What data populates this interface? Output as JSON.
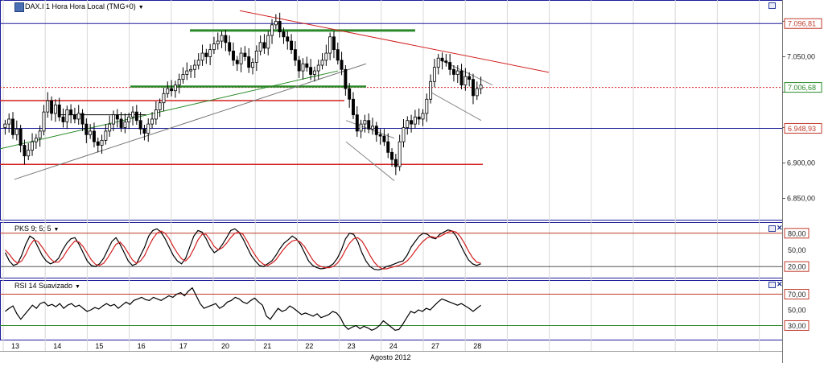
{
  "main_panel": {
    "title": "DAX.I 1 Hora Hora Local (TMG+0)"
  },
  "pks_panel": {
    "title": "PKS 9; 5; 5"
  },
  "rsi_panel": {
    "title": "RSI 14 Suavizado"
  },
  "x_axis": {
    "month_label": "Agosto 2012"
  },
  "colors": {
    "up": "#ffffff",
    "down": "#000000",
    "red": "#d32020",
    "green": "#2a8a2a",
    "blue": "#1c1c9a",
    "panel_border": "#1c1c9a"
  },
  "chart_data": [
    {
      "type": "candlestick",
      "title": "DAX.I 1 Hora Hora Local (TMG+0)",
      "x_labels": [
        "13",
        "14",
        "15",
        "16",
        "17",
        "20",
        "21",
        "22",
        "23",
        "24",
        "27",
        "28"
      ],
      "ylim": [
        6820,
        7130
      ],
      "y_ticks": [
        6850,
        6900,
        6950,
        7000,
        7050,
        7100
      ],
      "y_tick_labels": [
        "6.850,00",
        "6.900,00",
        "",
        "",
        "7.050,00",
        ""
      ],
      "price_labels": [
        {
          "value": 7096.81,
          "text": "7.096,81",
          "color": "#c0392b"
        },
        {
          "value": 7006.68,
          "text": "7.006,68",
          "color": "#2a8a2a"
        },
        {
          "value": 6948.93,
          "text": "6.948,93",
          "color": "#c0392b"
        }
      ],
      "closes": [
        6955,
        6962,
        6940,
        6948,
        6925,
        6910,
        6918,
        6930,
        6935,
        6945,
        6972,
        6988,
        6970,
        6982,
        6965,
        6958,
        6975,
        6968,
        6962,
        6970,
        6955,
        6940,
        6945,
        6930,
        6925,
        6932,
        6945,
        6955,
        6968,
        6962,
        6950,
        6958,
        6965,
        6972,
        6960,
        6948,
        6942,
        6955,
        6962,
        6975,
        6985,
        6998,
        7005,
        7002,
        7010,
        7018,
        7025,
        7030,
        7032,
        7038,
        7045,
        7055,
        7050,
        7060,
        7068,
        7072,
        7080,
        7070,
        7058,
        7045,
        7040,
        7055,
        7050,
        7035,
        7042,
        7058,
        7070,
        7062,
        7080,
        7095,
        7100,
        7085,
        7078,
        7072,
        7060,
        7045,
        7030,
        7040,
        7035,
        7025,
        7030,
        7038,
        7045,
        7055,
        7078,
        7060,
        7045,
        7032,
        7005,
        6990,
        6968,
        6945,
        6955,
        6960,
        6948,
        6952,
        6940,
        6938,
        6930,
        6915,
        6905,
        6895,
        6930,
        6950,
        6960,
        6955,
        6965,
        6962,
        6970,
        6990,
        7015,
        7035,
        7048,
        7044,
        7042,
        7032,
        7025,
        7030,
        7010,
        7022,
        7018,
        6995,
        7005,
        7010
      ],
      "levels": [
        {
          "name": "blue-line-7096",
          "value": 7096.81,
          "color": "#1c1c9a"
        },
        {
          "name": "blue-line-6948",
          "value": 6948.93,
          "color": "#1c1c9a"
        }
      ]
    },
    {
      "type": "line",
      "title": "PKS 9; 5; 5",
      "ylim": [
        0,
        100
      ],
      "y_ticks": [
        20,
        50,
        80
      ],
      "y_tick_labels": [
        "20,00",
        "50,00",
        "80,00"
      ],
      "series": [
        {
          "color": "#000000",
          "values": [
            45,
            30,
            22,
            25,
            40,
            60,
            75,
            70,
            55,
            40,
            30,
            25,
            28,
            35,
            50,
            62,
            70,
            72,
            60,
            45,
            30,
            22,
            20,
            25,
            35,
            50,
            65,
            72,
            60,
            45,
            30,
            22,
            25,
            40,
            55,
            75,
            85,
            88,
            82,
            70,
            55,
            40,
            30,
            25,
            35,
            55,
            75,
            85,
            82,
            70,
            55,
            45,
            50,
            60,
            72,
            85,
            88,
            82,
            70,
            55,
            40,
            30,
            22,
            20,
            25,
            30,
            40,
            52,
            62,
            68,
            75,
            70,
            60,
            45,
            30,
            22,
            18,
            16,
            17,
            20,
            25,
            35,
            50,
            70,
            80,
            78,
            65,
            45,
            30,
            20,
            15,
            14,
            16,
            20,
            22,
            25,
            28,
            30,
            40,
            55,
            65,
            75,
            80,
            78,
            72,
            70,
            78,
            82,
            86,
            84,
            75,
            60,
            45,
            32,
            25,
            22,
            25
          ]
        },
        {
          "color": "#d32020",
          "values": [
            50,
            42,
            32,
            26,
            30,
            42,
            58,
            68,
            65,
            55,
            44,
            34,
            28,
            28,
            36,
            48,
            58,
            66,
            64,
            56,
            44,
            32,
            24,
            22,
            26,
            36,
            48,
            60,
            64,
            56,
            44,
            32,
            26,
            30,
            40,
            56,
            70,
            80,
            84,
            80,
            70,
            56,
            44,
            34,
            30,
            38,
            52,
            68,
            78,
            78,
            68,
            56,
            50,
            54,
            62,
            72,
            80,
            82,
            78,
            66,
            52,
            40,
            30,
            24,
            22,
            26,
            32,
            42,
            52,
            60,
            66,
            68,
            64,
            56,
            44,
            32,
            24,
            20,
            18,
            18,
            20,
            26,
            36,
            50,
            62,
            70,
            72,
            66,
            54,
            40,
            28,
            20,
            16,
            16,
            18,
            20,
            22,
            25,
            30,
            38,
            48,
            58,
            66,
            72,
            74,
            72,
            74,
            78,
            82,
            84,
            82,
            74,
            62,
            48,
            36,
            28,
            26
          ]
        }
      ]
    },
    {
      "type": "line",
      "title": "RSI 14 Suavizado",
      "ylim": [
        12,
        88
      ],
      "y_ticks": [
        30,
        50,
        70
      ],
      "y_tick_labels": [
        "30,00",
        "50,00",
        "70,00"
      ],
      "series": [
        {
          "color": "#000000",
          "values": [
            48,
            52,
            55,
            45,
            38,
            44,
            50,
            56,
            52,
            58,
            60,
            55,
            57,
            54,
            58,
            52,
            56,
            58,
            54,
            56,
            52,
            48,
            50,
            53,
            51,
            55,
            58,
            55,
            57,
            52,
            56,
            60,
            57,
            62,
            64,
            66,
            63,
            62,
            66,
            64,
            62,
            65,
            68,
            66,
            70,
            72,
            68,
            74,
            78,
            68,
            58,
            52,
            54,
            56,
            58,
            52,
            55,
            60,
            62,
            66,
            64,
            60,
            58,
            62,
            65,
            60,
            56,
            42,
            38,
            45,
            52,
            48,
            50,
            55,
            52,
            48,
            44,
            46,
            44,
            42,
            45,
            40,
            42,
            44,
            48,
            46,
            40,
            30,
            25,
            28,
            30,
            26,
            29,
            27,
            24,
            26,
            30,
            36,
            32,
            28,
            24,
            25,
            32,
            40,
            48,
            46,
            50,
            48,
            52,
            50,
            55,
            60,
            64,
            62,
            60,
            58,
            56,
            58,
            55,
            52,
            48,
            52,
            56
          ]
        }
      ]
    }
  ]
}
